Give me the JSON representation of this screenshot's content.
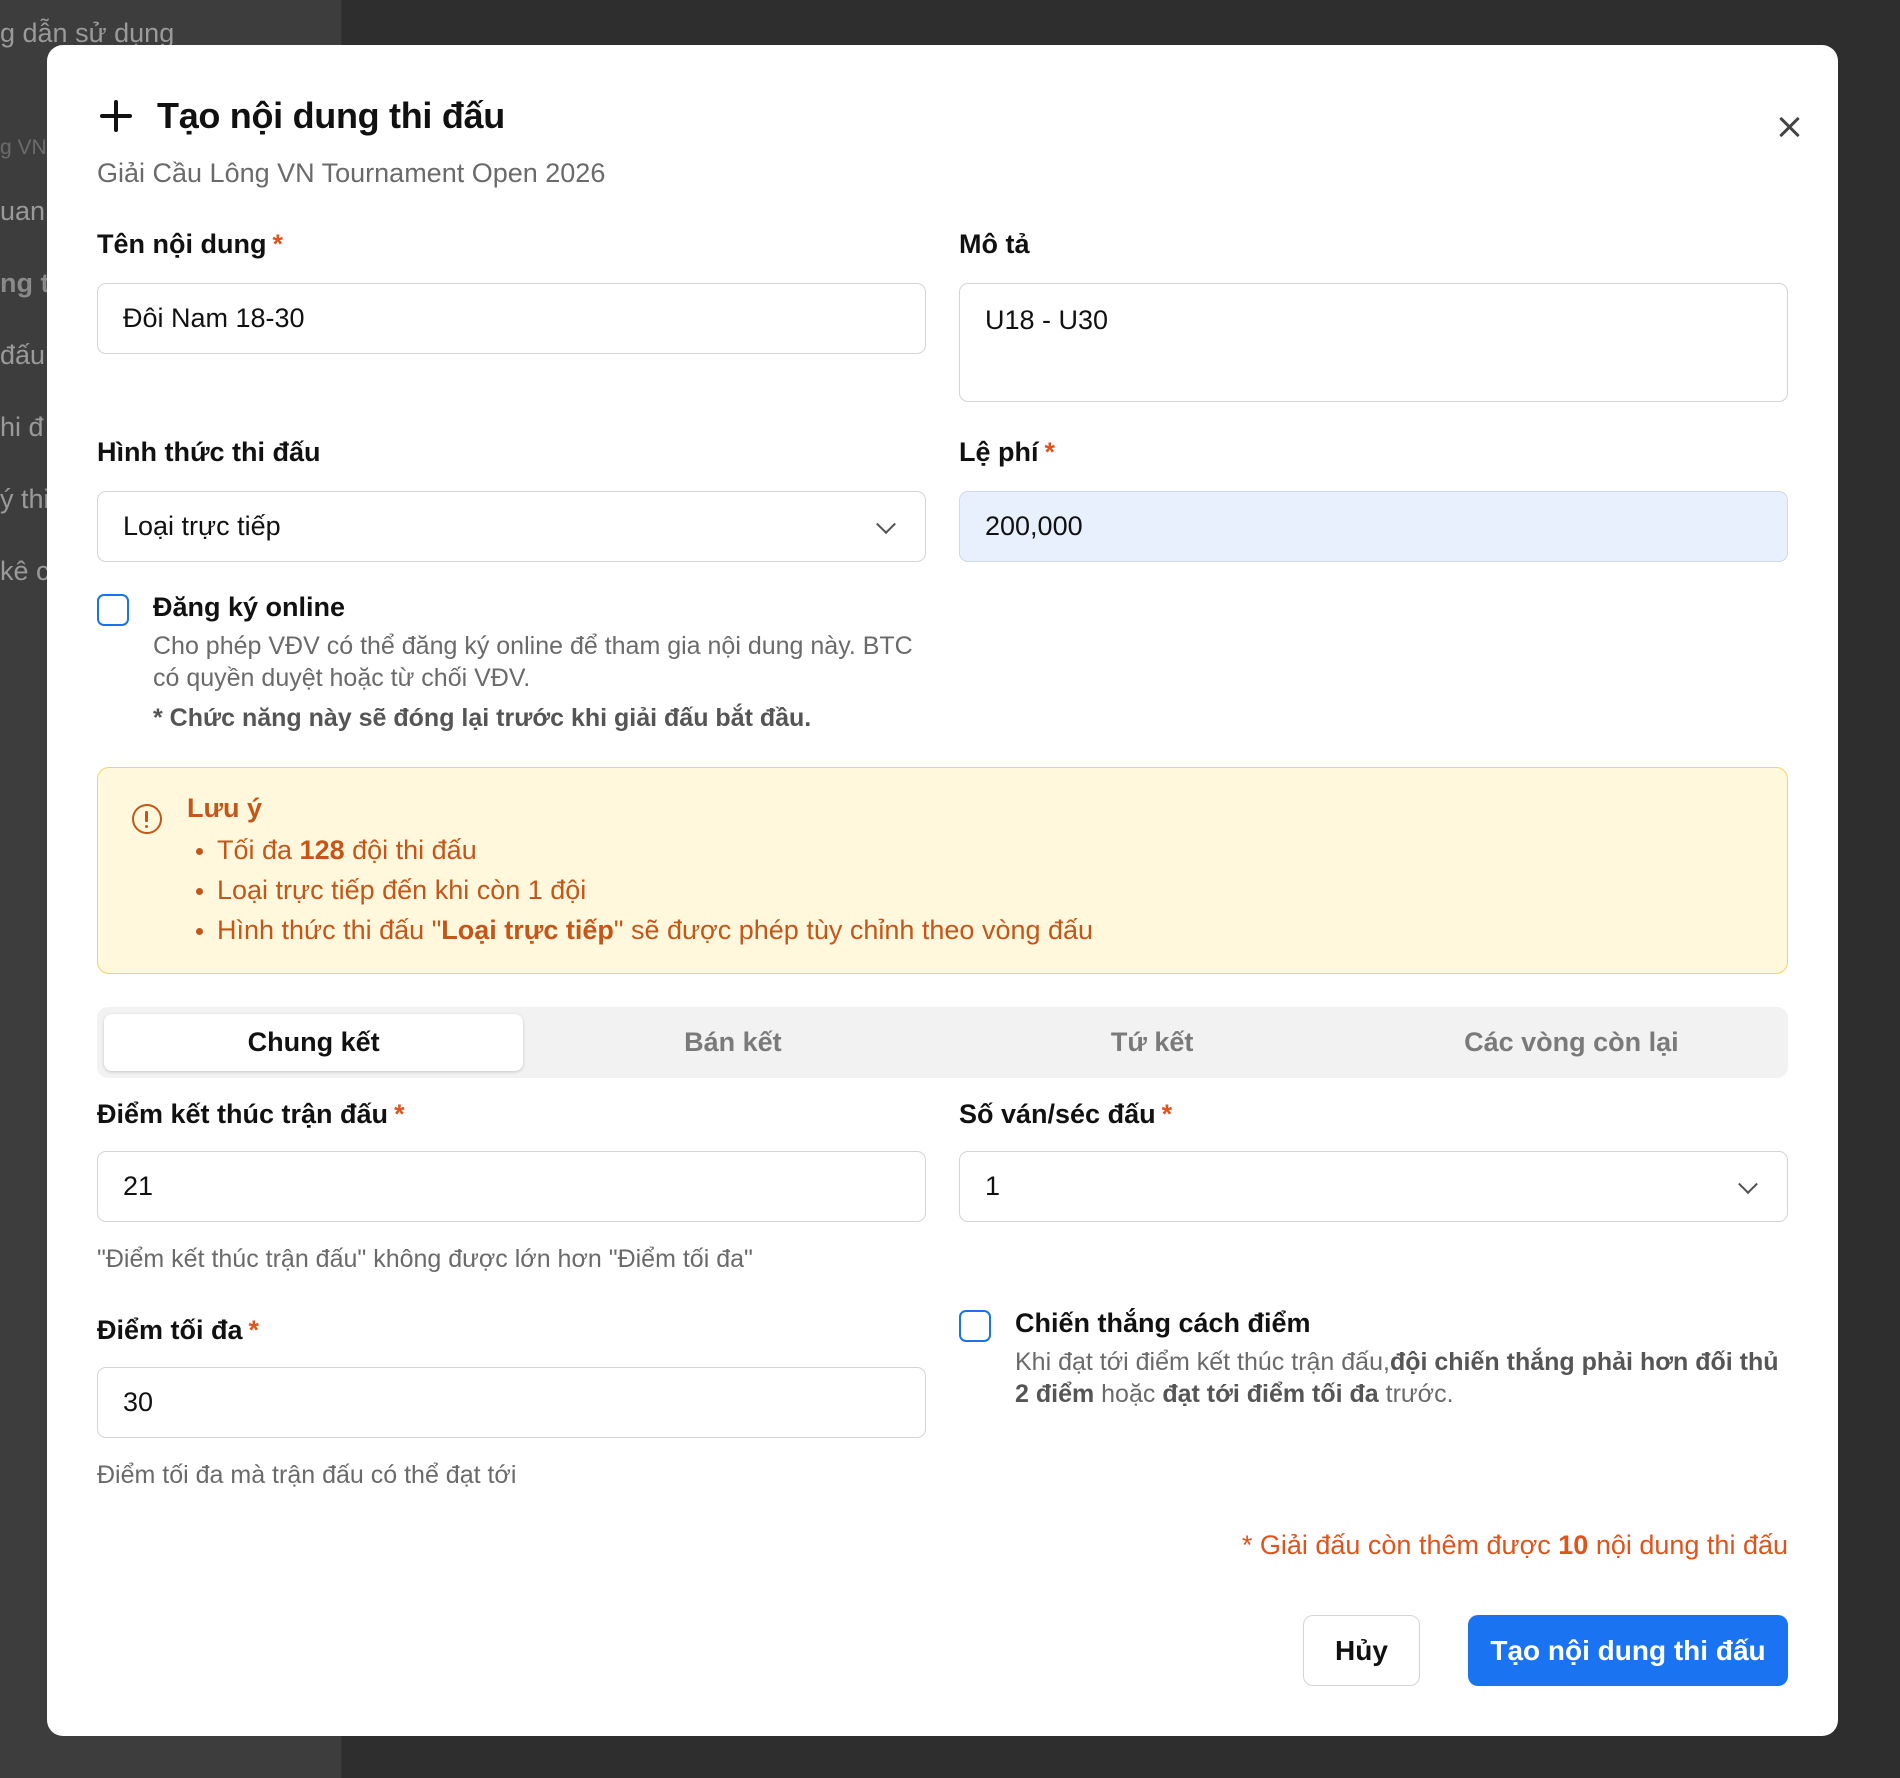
{
  "background": {
    "sidebar_items": [
      "g dẫn sử dụng",
      "g VN",
      "uan",
      "ng th",
      "đấu",
      "hi đ",
      "ý thi",
      "kê c"
    ]
  },
  "modal": {
    "title": "Tạo nội dung thi đấu",
    "subtitle": "Giải Cầu Lông VN Tournament Open 2026",
    "fields": {
      "name": {
        "label": "Tên nội dung",
        "required_mark": "*",
        "value": "Đôi Nam 18-30"
      },
      "description": {
        "label": "Mô tả",
        "value": "U18 - U30"
      },
      "format": {
        "label": "Hình thức thi đấu",
        "value": "Loại trực tiếp"
      },
      "fee": {
        "label": "Lệ phí",
        "required_mark": "*",
        "value": "200,000"
      }
    },
    "online_registration": {
      "label": "Đăng ký online",
      "checked": false,
      "description": "Cho phép VĐV có thể đăng ký online để tham gia nội dung này. BTC có quyền duyệt hoặc từ chối VĐV.",
      "note": "* Chức năng này sẽ đóng lại trước khi giải đấu bắt đầu."
    },
    "notice": {
      "title": "Lưu ý",
      "item1_pre": "Tối đa ",
      "item1_bold": "128",
      "item1_post": " đội thi đấu",
      "item2": "Loại trực tiếp đến khi còn 1 đội",
      "item3_pre": "Hình thức thi đấu \"",
      "item3_bold": "Loại trực tiếp",
      "item3_post": "\" sẽ được phép tùy chỉnh theo vòng đấu"
    },
    "tabs": [
      "Chung kết",
      "Bán kết",
      "Tứ kết",
      "Các vòng còn lại"
    ],
    "active_tab": 0,
    "round": {
      "end_score": {
        "label": "Điểm kết thúc trận đấu",
        "required_mark": "*",
        "value": "21",
        "helper": "\"Điểm kết thúc trận đấu\" không được lớn hơn \"Điểm tối đa\""
      },
      "games": {
        "label": "Số ván/séc đấu",
        "required_mark": "*",
        "value": "1"
      },
      "max_score": {
        "label": "Điểm tối đa",
        "required_mark": "*",
        "value": "30",
        "helper": "Điểm tối đa mà trận đấu có thể đạt tới"
      },
      "win_by": {
        "label": "Chiến thắng cách điểm",
        "checked": false,
        "desc_pre": "Khi đạt tới điểm kết thúc trận đấu,",
        "desc_bold1": "đội chiến thắng phải hơn đối thủ 2 điểm",
        "desc_mid": " hoặc ",
        "desc_bold2": "đạt tới điểm tối đa",
        "desc_post": " trước."
      }
    },
    "remaining_pre": "* Giải đấu còn thêm được ",
    "remaining_count": "10",
    "remaining_post": " nội dung thi đấu",
    "buttons": {
      "cancel": "Hủy",
      "submit": "Tạo nội dung thi đấu"
    }
  },
  "colors": {
    "primary": "#1a73f0",
    "required": "#e0541c",
    "notice_text": "#c4561a",
    "notice_bg": "#fff8dc",
    "fee_bg": "#e9f0fd"
  }
}
